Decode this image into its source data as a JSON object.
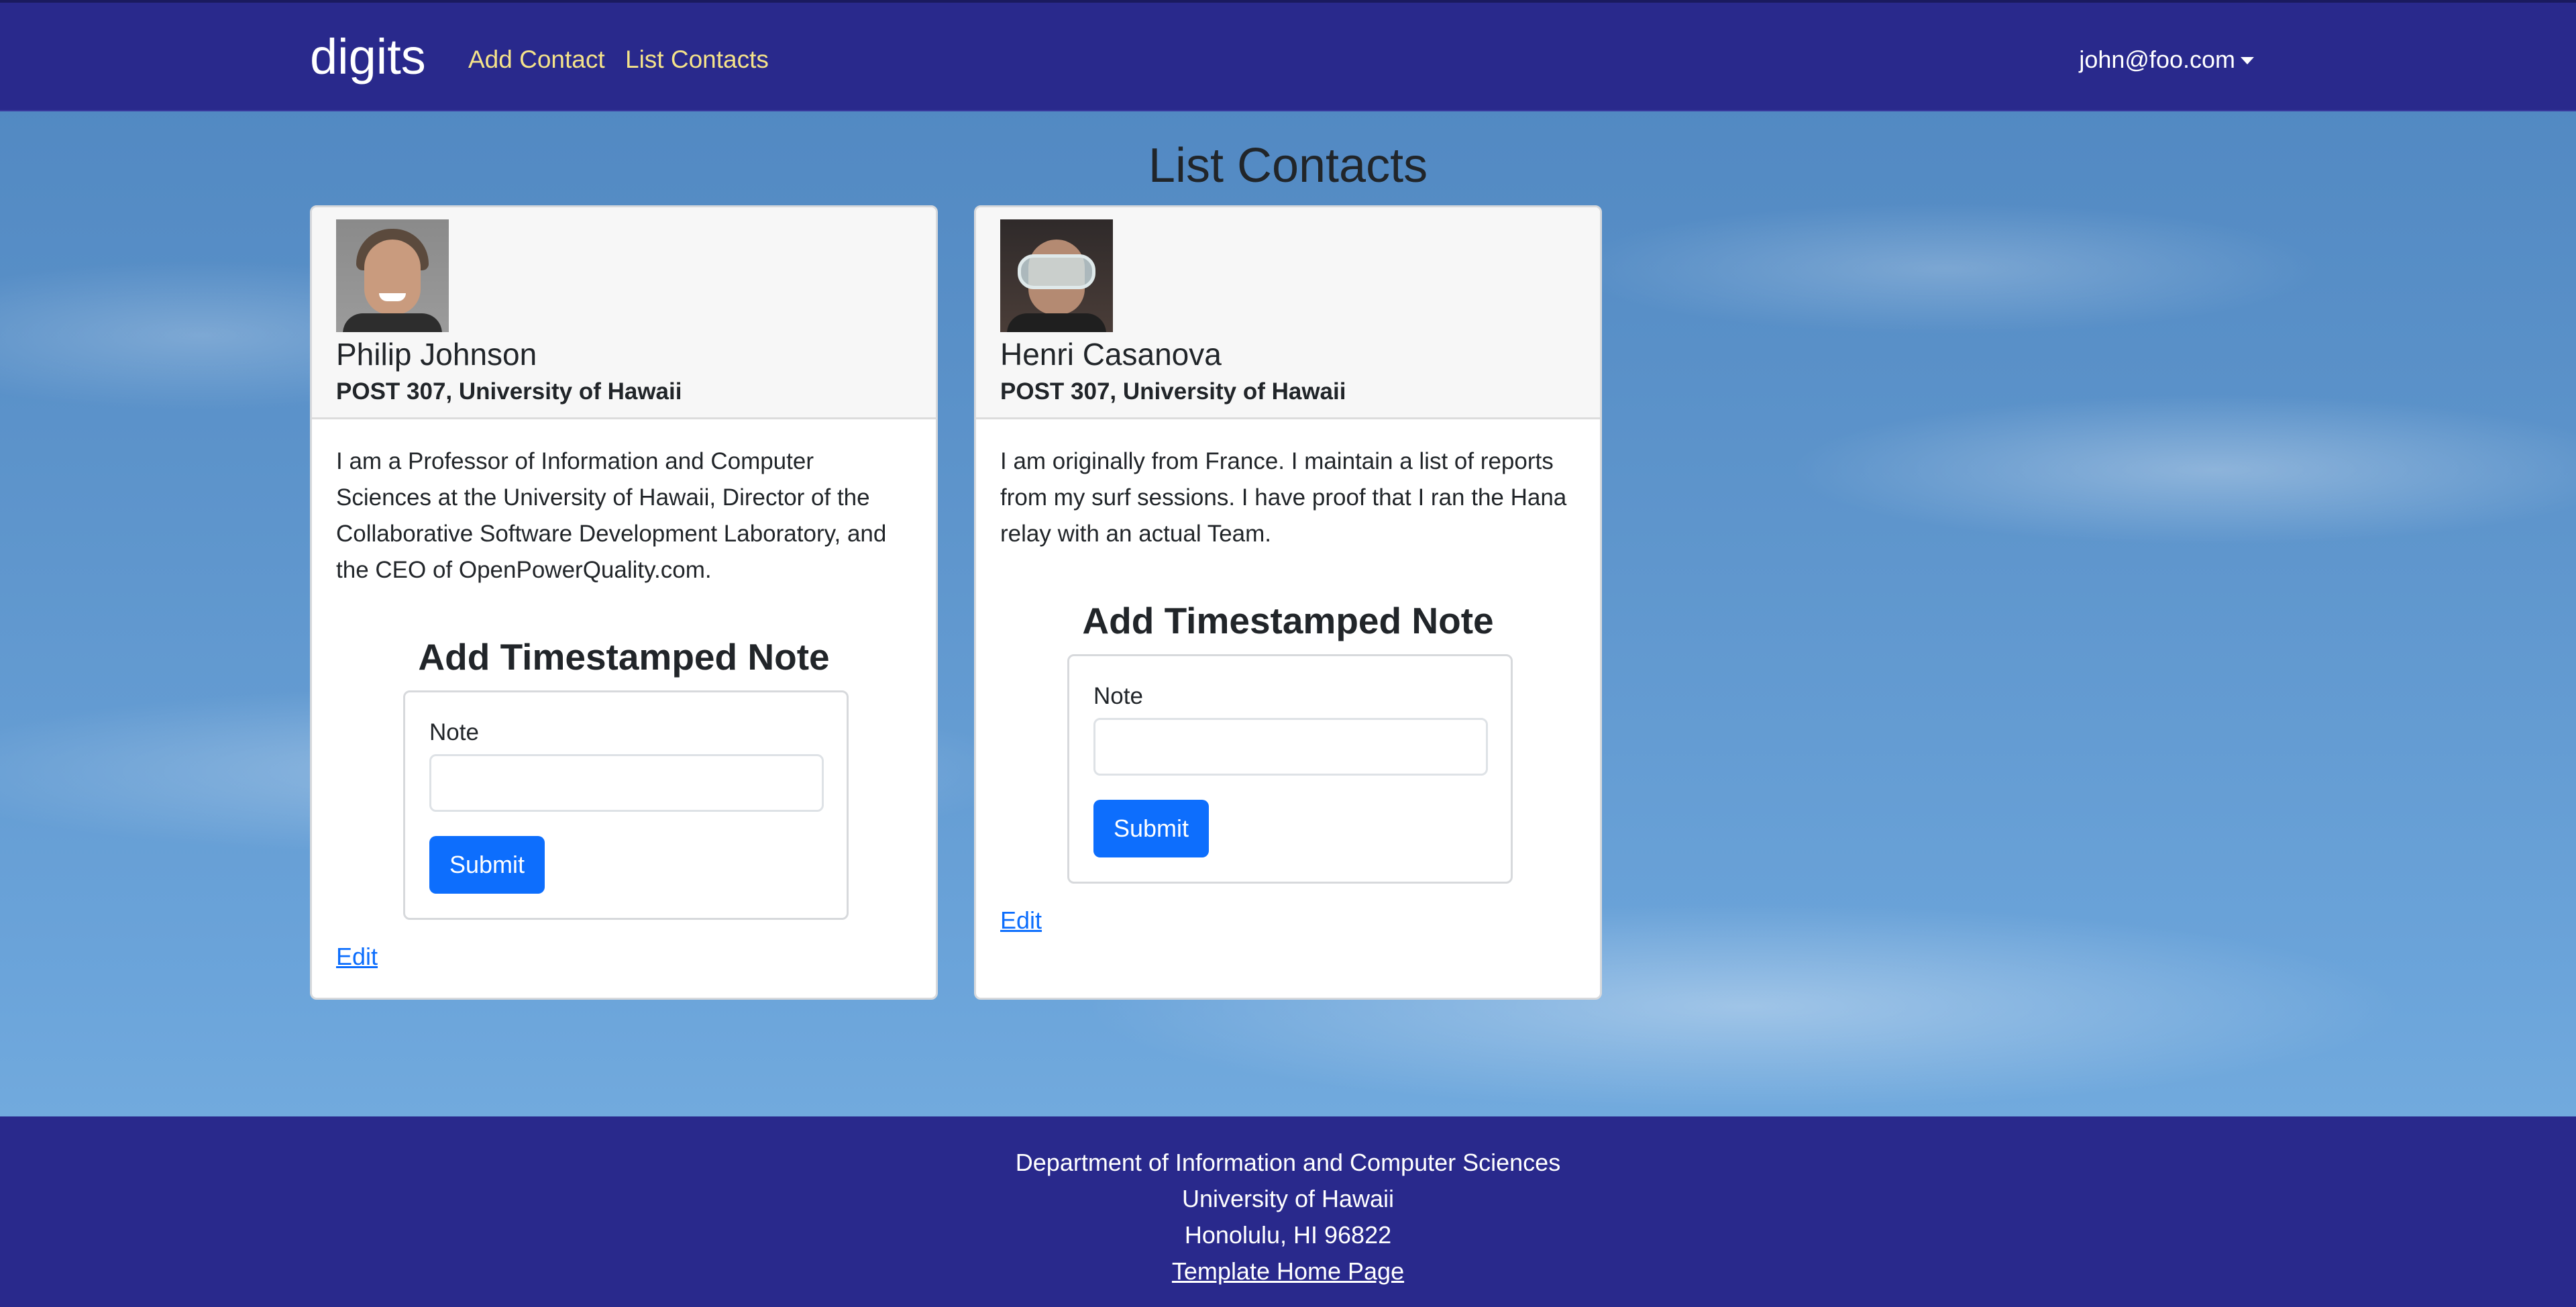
{
  "navbar": {
    "brand": "digits",
    "links": [
      {
        "label": "Add Contact"
      },
      {
        "label": "List Contacts"
      }
    ],
    "user": "john@foo.com"
  },
  "page": {
    "title": "List Contacts"
  },
  "contacts": [
    {
      "name": "Philip Johnson",
      "address": "POST 307, University of Hawaii",
      "description": "I am a Professor of Information and Computer Sciences at the University of Hawaii, Director of the Collaborative Software Development Laboratory, and the CEO of OpenPowerQuality.com.",
      "note_title": "Add Timestamped Note",
      "note_label": "Note",
      "note_value": "",
      "submit_label": "Submit",
      "edit_label": "Edit"
    },
    {
      "name": "Henri Casanova",
      "address": "POST 307, University of Hawaii",
      "description": "I am originally from France. I maintain a list of reports from my surf sessions. I have proof that I ran the Hana relay with an actual Team.",
      "note_title": "Add Timestamped Note",
      "note_label": "Note",
      "note_value": "",
      "submit_label": "Submit",
      "edit_label": "Edit"
    }
  ],
  "footer": {
    "lines": [
      "Department of Information and Computer Sciences",
      "University of Hawaii",
      "Honolulu, HI 96822"
    ],
    "link": "Template Home Page"
  },
  "colors": {
    "navbar": "#29298c",
    "nav_link": "#f5e38a",
    "primary_button": "#0d6efd",
    "link": "#0d6efd"
  }
}
